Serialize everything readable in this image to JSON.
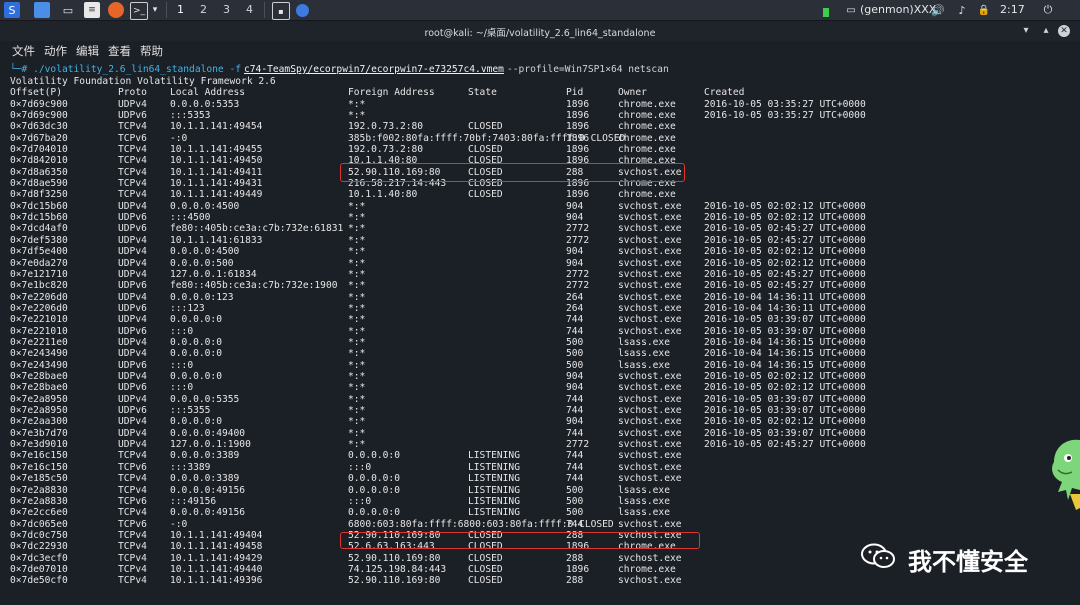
{
  "taskbar": {
    "workspaces": [
      "1",
      "2",
      "3",
      "4"
    ],
    "tray_user": "(genmon)XXX",
    "clock": "2:17"
  },
  "window": {
    "title": "root@kali: ~/桌面/volatility_2.6_lin64_standalone"
  },
  "menu": [
    "文件",
    "动作",
    "编辑",
    "查看",
    "帮助"
  ],
  "terminal": {
    "prompt_user": "└─# ./volatility_2.6_lin64_standalone -f",
    "prompt_path": "c74-TeamSpy/ecorpwin7/ecorpwin7-e73257c4.vmem",
    "prompt_args": "--profile=Win7SP1×64 netscan",
    "banner": "Volatility Foundation Volatility Framework 2.6",
    "headers": [
      "Offset(P)",
      "Proto",
      "Local Address",
      "Foreign Address",
      "State",
      "Pid",
      "Owner",
      "Created"
    ],
    "rows": [
      [
        "0×7d69c900",
        "UDPv4",
        "0.0.0.0:5353",
        "*:*",
        "",
        "1896",
        "chrome.exe",
        "2016-10-05 03:35:27 UTC+0000"
      ],
      [
        "0×7d69c900",
        "UDPv6",
        ":::5353",
        "*:*",
        "",
        "1896",
        "chrome.exe",
        "2016-10-05 03:35:27 UTC+0000"
      ],
      [
        "0×7d63dc30",
        "TCPv4",
        "10.1.1.141:49454",
        "192.0.73.2:80",
        "CLOSED",
        "1896",
        "chrome.exe",
        ""
      ],
      [
        "0×7d67ba20",
        "TCPv6",
        "-:0",
        "385b:f002:80fa:ffff:70bf:7403:80fa:ffff:0 CLOSED",
        "",
        "1896",
        "chrome.exe",
        ""
      ],
      [
        "0×7d704010",
        "TCPv4",
        "10.1.1.141:49455",
        "192.0.73.2:80",
        "CLOSED",
        "1896",
        "chrome.exe",
        ""
      ],
      [
        "0×7d842010",
        "TCPv4",
        "10.1.1.141:49450",
        "10.1.1.40:80",
        "CLOSED",
        "1896",
        "chrome.exe",
        ""
      ],
      [
        "0×7d8a6350",
        "TCPv4",
        "10.1.1.141:49411",
        "52.90.110.169:80",
        "CLOSED",
        "288",
        "svchost.exe",
        ""
      ],
      [
        "0×7d8ae590",
        "TCPv4",
        "10.1.1.141:49431",
        "216.58.217.14:443",
        "CLOSED",
        "1896",
        "chrome.exe",
        ""
      ],
      [
        "0×7d8f3250",
        "TCPv4",
        "10.1.1.141:49449",
        "10.1.1.40:80",
        "CLOSED",
        "1896",
        "chrome.exe",
        ""
      ],
      [
        "0×7dc15b60",
        "UDPv4",
        "0.0.0.0:4500",
        "*:*",
        "",
        "904",
        "svchost.exe",
        "2016-10-05 02:02:12 UTC+0000"
      ],
      [
        "0×7dc15b60",
        "UDPv6",
        ":::4500",
        "*:*",
        "",
        "904",
        "svchost.exe",
        "2016-10-05 02:02:12 UTC+0000"
      ],
      [
        "0×7dcd4af0",
        "UDPv6",
        "fe80::405b:ce3a:c7b:732e:61831",
        "*:*",
        "",
        "2772",
        "svchost.exe",
        "2016-10-05 02:45:27 UTC+0000"
      ],
      [
        "0×7def5380",
        "UDPv4",
        "10.1.1.141:61833",
        "*:*",
        "",
        "2772",
        "svchost.exe",
        "2016-10-05 02:45:27 UTC+0000"
      ],
      [
        "0×7df5e400",
        "UDPv4",
        "0.0.0.0:4500",
        "*:*",
        "",
        "904",
        "svchost.exe",
        "2016-10-05 02:02:12 UTC+0000"
      ],
      [
        "0×7e0da270",
        "UDPv4",
        "0.0.0.0:500",
        "*:*",
        "",
        "904",
        "svchost.exe",
        "2016-10-05 02:02:12 UTC+0000"
      ],
      [
        "0×7e121710",
        "UDPv4",
        "127.0.0.1:61834",
        "*:*",
        "",
        "2772",
        "svchost.exe",
        "2016-10-05 02:45:27 UTC+0000"
      ],
      [
        "0×7e1bc820",
        "UDPv6",
        "fe80::405b:ce3a:c7b:732e:1900",
        "*:*",
        "",
        "2772",
        "svchost.exe",
        "2016-10-05 02:45:27 UTC+0000"
      ],
      [
        "0×7e2206d0",
        "UDPv4",
        "0.0.0.0:123",
        "*:*",
        "",
        "264",
        "svchost.exe",
        "2016-10-04 14:36:11 UTC+0000"
      ],
      [
        "0×7e2206d0",
        "UDPv6",
        ":::123",
        "*:*",
        "",
        "264",
        "svchost.exe",
        "2016-10-04 14:36:11 UTC+0000"
      ],
      [
        "0×7e221010",
        "UDPv4",
        "0.0.0.0:0",
        "*:*",
        "",
        "744",
        "svchost.exe",
        "2016-10-05 03:39:07 UTC+0000"
      ],
      [
        "0×7e221010",
        "UDPv6",
        ":::0",
        "*:*",
        "",
        "744",
        "svchost.exe",
        "2016-10-05 03:39:07 UTC+0000"
      ],
      [
        "0×7e2211e0",
        "UDPv4",
        "0.0.0.0:0",
        "*:*",
        "",
        "500",
        "lsass.exe",
        "2016-10-04 14:36:15 UTC+0000"
      ],
      [
        "0×7e243490",
        "UDPv4",
        "0.0.0.0:0",
        "*:*",
        "",
        "500",
        "lsass.exe",
        "2016-10-04 14:36:15 UTC+0000"
      ],
      [
        "0×7e243490",
        "UDPv6",
        ":::0",
        "*:*",
        "",
        "500",
        "lsass.exe",
        "2016-10-04 14:36:15 UTC+0000"
      ],
      [
        "0×7e28bae0",
        "UDPv4",
        "0.0.0.0:0",
        "*:*",
        "",
        "904",
        "svchost.exe",
        "2016-10-05 02:02:12 UTC+0000"
      ],
      [
        "0×7e28bae0",
        "UDPv6",
        ":::0",
        "*:*",
        "",
        "904",
        "svchost.exe",
        "2016-10-05 02:02:12 UTC+0000"
      ],
      [
        "0×7e2a8950",
        "UDPv4",
        "0.0.0.0:5355",
        "*:*",
        "",
        "744",
        "svchost.exe",
        "2016-10-05 03:39:07 UTC+0000"
      ],
      [
        "0×7e2a8950",
        "UDPv6",
        ":::5355",
        "*:*",
        "",
        "744",
        "svchost.exe",
        "2016-10-05 03:39:07 UTC+0000"
      ],
      [
        "0×7e2aa300",
        "UDPv4",
        "0.0.0.0:0",
        "*:*",
        "",
        "904",
        "svchost.exe",
        "2016-10-05 02:02:12 UTC+0000"
      ],
      [
        "0×7e3b7d70",
        "UDPv4",
        "0.0.0.0:49400",
        "*:*",
        "",
        "744",
        "svchost.exe",
        "2016-10-05 03:39:07 UTC+0000"
      ],
      [
        "0×7e3d9010",
        "UDPv4",
        "127.0.0.1:1900",
        "*:*",
        "",
        "2772",
        "svchost.exe",
        "2016-10-05 02:45:27 UTC+0000"
      ],
      [
        "0×7e16c150",
        "TCPv4",
        "0.0.0.0:3389",
        "0.0.0.0:0",
        "LISTENING",
        "744",
        "svchost.exe",
        ""
      ],
      [
        "0×7e16c150",
        "TCPv6",
        ":::3389",
        ":::0",
        "LISTENING",
        "744",
        "svchost.exe",
        ""
      ],
      [
        "0×7e185c50",
        "TCPv4",
        "0.0.0.0:3389",
        "0.0.0.0:0",
        "LISTENING",
        "744",
        "svchost.exe",
        ""
      ],
      [
        "0×7e2a8830",
        "TCPv4",
        "0.0.0.0:49156",
        "0.0.0.0:0",
        "LISTENING",
        "500",
        "lsass.exe",
        ""
      ],
      [
        "0×7e2a8830",
        "TCPv6",
        ":::49156",
        ":::0",
        "LISTENING",
        "500",
        "lsass.exe",
        ""
      ],
      [
        "0×7e2cc6e0",
        "TCPv4",
        "0.0.0.0:49156",
        "0.0.0.0:0",
        "LISTENING",
        "500",
        "lsass.exe",
        ""
      ],
      [
        "0×7dc065e0",
        "TCPv6",
        "-:0",
        "6800:603:80fa:ffff:6800:603:80fa:ffff:0 CLOSED",
        "",
        "744",
        "svchost.exe",
        ""
      ],
      [
        "0×7dc0c750",
        "TCPv4",
        "10.1.1.141:49404",
        "52.90.110.169:80",
        "CLOSED",
        "288",
        "svchost.exe",
        ""
      ],
      [
        "0×7dc22930",
        "TCPv4",
        "10.1.1.141:49458",
        "52.6.63.163:443",
        "CLOSED",
        "1896",
        "chrome.exe",
        ""
      ],
      [
        "0×7dc3ecf0",
        "TCPv4",
        "10.1.1.141:49429",
        "52.90.110.169:80",
        "CLOSED",
        "288",
        "svchost.exe",
        ""
      ],
      [
        "0×7de07010",
        "TCPv4",
        "10.1.1.141:49440",
        "74.125.198.84:443",
        "CLOSED",
        "1896",
        "chrome.exe",
        ""
      ],
      [
        "0×7de50cf0",
        "TCPv4",
        "10.1.1.141:49396",
        "52.90.110.169:80",
        "CLOSED",
        "288",
        "svchost.exe",
        ""
      ]
    ]
  },
  "watermark": {
    "text": "我不懂安全"
  }
}
